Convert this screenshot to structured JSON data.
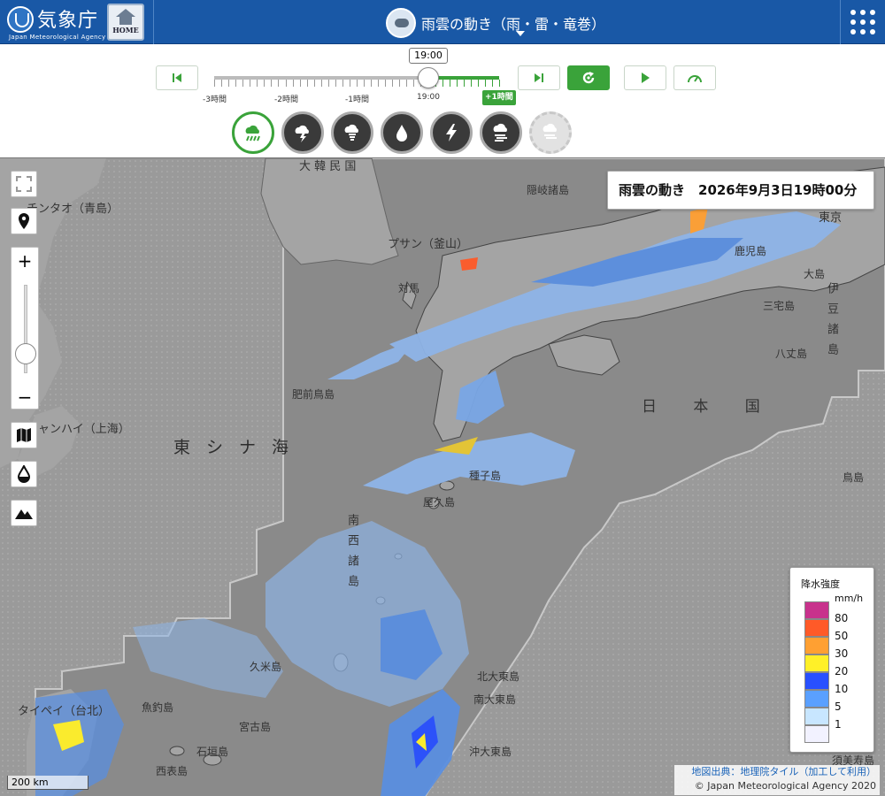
{
  "header": {
    "logo_name": "気象庁",
    "logo_en": "Japan Meteorological Agency",
    "home_label": "HOME",
    "title": "雨雲の動き（雨・雷・竜巻）"
  },
  "playback": {
    "current_time": "19:00",
    "tick_labels": [
      "-3時間",
      "-2時間",
      "-1時間",
      "19:00"
    ],
    "future_label": "+1時間",
    "slider_position": 0.75
  },
  "modes": [
    {
      "name": "rain-cloud",
      "active": true
    },
    {
      "name": "thunder",
      "active": false
    },
    {
      "name": "tornado",
      "active": false
    },
    {
      "name": "rain-drop",
      "active": false
    },
    {
      "name": "lightning",
      "active": false
    },
    {
      "name": "wind-rain",
      "active": false
    },
    {
      "name": "disabled",
      "active": false
    }
  ],
  "map": {
    "info_title": "雨雲の動き　2026年9月3日19時00分",
    "labels": {
      "korea": "大 韓 民 国",
      "qingdao": "チンタオ（青島）",
      "busan": "プサン（釜山）",
      "shanghai": "シャンハイ（上海）",
      "east_china_sea": "東シナ海",
      "japan": "日 本 国",
      "tokyo": "東京",
      "oki": "隠岐諸島",
      "tsushima": "対馬",
      "hizen": "肥前鳥島",
      "tanegashima": "種子島",
      "yakushima": "屋久島",
      "nansei": "南西諸島",
      "kume": "久米島",
      "kitadaito": "北大東島",
      "minamidaito": "南大東島",
      "okidaito": "沖大東島",
      "uotsuri": "魚釣島",
      "miyako": "宮古島",
      "ishigaki": "石垣島",
      "iriomote": "西表島",
      "taipei": "タイペイ（台北）",
      "izu": "伊豆諸島",
      "miyake": "三宅島",
      "oshima": "大島",
      "hachijo": "八丈島",
      "torishima": "鳥島",
      "kagoshima": "鹿児島",
      "sumisu": "須美寿島"
    },
    "zoom_in": "+",
    "zoom_out": "−",
    "zoom_level": 0.7,
    "scale_label": "200 km",
    "attribution_source": "地図出典：地理院タイル（加工して利用）",
    "attribution_copy": "© Japan Meteorological Agency 2020"
  },
  "legend": {
    "title": "降水強度",
    "unit": "mm/h",
    "items": [
      {
        "value": "80",
        "color": "#c8328c"
      },
      {
        "value": "50",
        "color": "#ff5a28"
      },
      {
        "value": "30",
        "color": "#ffa032"
      },
      {
        "value": "20",
        "color": "#fff028"
      },
      {
        "value": "10",
        "color": "#2850ff"
      },
      {
        "value": "5",
        "color": "#5aa0ff"
      },
      {
        "value": "1",
        "color": "#c8e6ff"
      },
      {
        "value": "",
        "color": "#f2f2ff"
      }
    ]
  },
  "colors": {
    "header_bg": "#1958a6",
    "accent_green": "#3aa33a",
    "sea": "#8c8c8c",
    "land": "#a4a4a4"
  }
}
